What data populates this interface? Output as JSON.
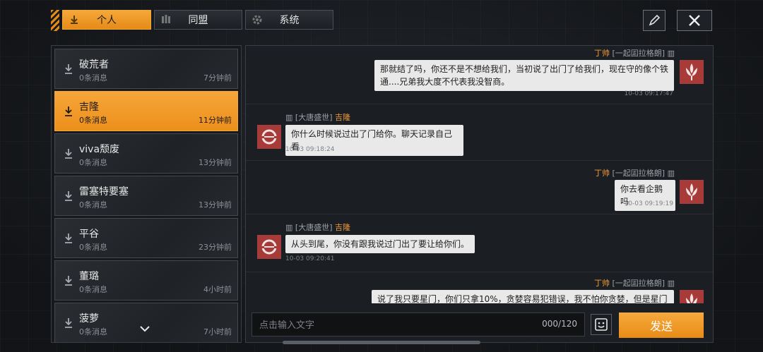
{
  "tabs": [
    {
      "label": "个人",
      "icon": "download-arrow-icon"
    },
    {
      "label": "同盟",
      "icon": "alliance-icon"
    },
    {
      "label": "系统",
      "icon": "gear-icon"
    }
  ],
  "toolbar": {
    "edit_icon": "pencil-icon",
    "close_icon": "close-icon"
  },
  "contacts": [
    {
      "name": "破荒者",
      "sub": "0条消息",
      "time": "7分钟前"
    },
    {
      "name": "吉隆",
      "sub": "0条消息",
      "time": "11分钟前",
      "active": true
    },
    {
      "name": "viva颓废",
      "sub": "0条消息",
      "time": "13分钟前"
    },
    {
      "name": "雷塞特要塞",
      "sub": "0条消息",
      "time": "13分钟前"
    },
    {
      "name": "平谷",
      "sub": "0条消息",
      "time": "23分钟前"
    },
    {
      "name": "董璐",
      "sub": "0条消息",
      "time": "4小时前"
    },
    {
      "name": "菠萝",
      "sub": "0条消息",
      "time": "7小时前"
    }
  ],
  "messages": [
    {
      "side": "right",
      "alliance": "[一起囸拉格朗]",
      "name": "丁帅",
      "text": "那就结了吗，你还不是不想给我们，当初说了出门了给我们，现在守的像个铁通....兄弟我大度不代表我没智商。",
      "stamp": "10-03 09:17:47"
    },
    {
      "side": "left",
      "alliance": "[大唐盛世]",
      "name": "吉隆",
      "text": "你什么时候说过出了门给你。聊天记录自己看",
      "stamp": "10-03 09:18:24"
    },
    {
      "side": "right",
      "alliance": "[一起囸拉格朗]",
      "name": "丁帅",
      "text": "你去看企鹅吗",
      "stamp": "10-03 09:19:19"
    },
    {
      "side": "left",
      "alliance": "[大唐盛世]",
      "name": "吉隆",
      "text": "从头到尾，你没有跟我说过门出了要让给你们。",
      "stamp": "10-03 09:20:41"
    },
    {
      "side": "right",
      "alliance": "[一起囸拉格朗]",
      "name": "丁帅",
      "text": "说了我只要星门，你们只拿10%，贪婪容易犯错误，我不怕你贪婪，但是星门",
      "stamp": ""
    }
  ],
  "input": {
    "placeholder": "点击输入文字",
    "counter": "000/120"
  },
  "send_label": "发送",
  "colors": {
    "accent": "#f0993a",
    "avatar_red": "#a83a38"
  }
}
